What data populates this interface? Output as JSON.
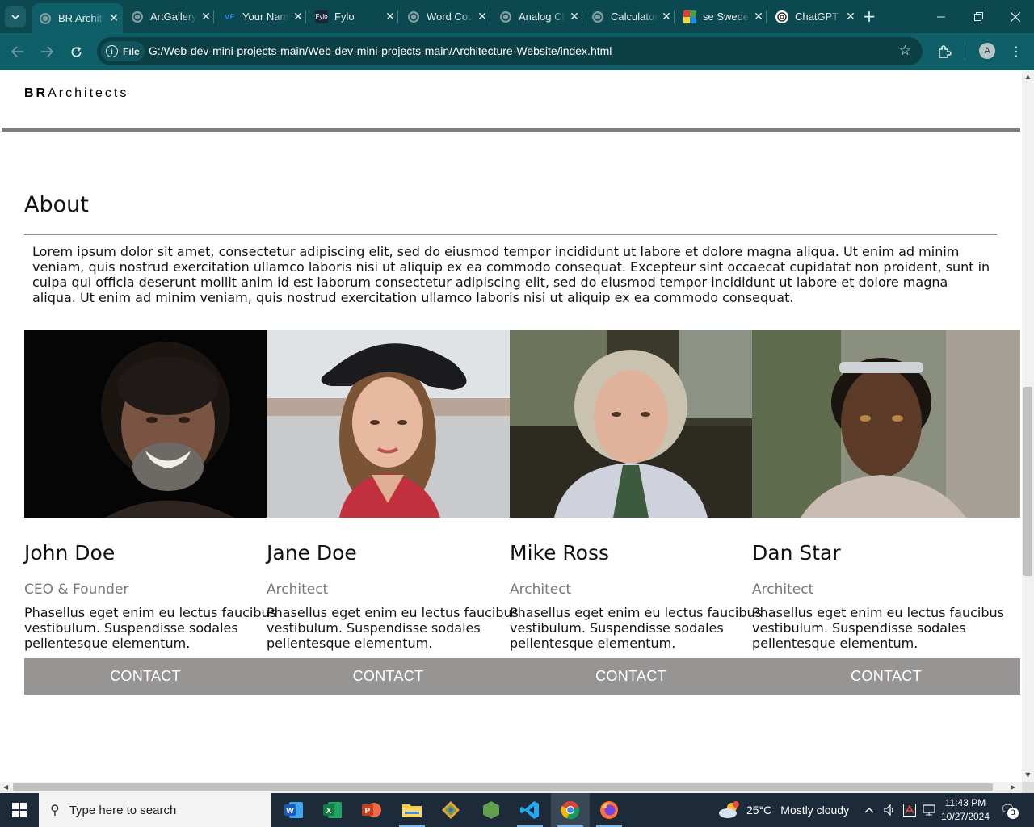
{
  "browser": {
    "tabs": [
      {
        "label": "BR Architects",
        "icon": "globe-icon",
        "active": true
      },
      {
        "label": "ArtGallery",
        "icon": "globe-icon"
      },
      {
        "label": "Your Name",
        "icon": "me-logo-icon",
        "favicon_text": "ME"
      },
      {
        "label": "Fylo",
        "icon": "fylo-logo-icon",
        "favicon_text": "Fylo"
      },
      {
        "label": "Word Counter",
        "icon": "globe-icon"
      },
      {
        "label": "Analog Clock",
        "icon": "globe-icon"
      },
      {
        "label": "Calculator",
        "icon": "globe-icon"
      },
      {
        "label": "se Sweden",
        "icon": "colorful-grid-icon"
      },
      {
        "label": "ChatGPT",
        "icon": "chatgpt-icon"
      }
    ],
    "omnibox": {
      "scheme_chip": "File",
      "url": "G:/Web-dev-mini-projects-main/Web-dev-mini-projects-main/Architecture-Website/index.html"
    },
    "profile_initial": "A"
  },
  "page": {
    "brand_bold": "BR",
    "brand_rest": "Architects",
    "about": {
      "title": "About",
      "text": "Lorem ipsum dolor sit amet, consectetur adipiscing elit, sed do eiusmod tempor incididunt ut labore et dolore magna aliqua. Ut enim ad minim veniam, quis nostrud exercitation ullamco laboris nisi ut aliquip ex ea commodo consequat. Excepteur sint occaecat cupidatat non proident, sunt in culpa qui officia deserunt mollit anim id est laborum consectetur adipiscing elit, sed do eiusmod tempor incididunt ut labore et dolore magna aliqua. Ut enim ad minim veniam, quis nostrud exercitation ullamco laboris nisi ut aliquip ex ea commodo consequat."
    },
    "team": [
      {
        "name": "John Doe",
        "role": "CEO & Founder",
        "desc": "Phasellus eget enim eu lectus faucibus vestibulum. Suspendisse sodales pellentesque elementum.",
        "contact": "CONTACT"
      },
      {
        "name": "Jane Doe",
        "role": "Architect",
        "desc": "Phasellus eget enim eu lectus faucibus vestibulum. Suspendisse sodales pellentesque elementum.",
        "contact": "CONTACT"
      },
      {
        "name": "Mike Ross",
        "role": "Architect",
        "desc": "Phasellus eget enim eu lectus faucibus vestibulum. Suspendisse sodales pellentesque elementum.",
        "contact": "CONTACT"
      },
      {
        "name": "Dan Star",
        "role": "Architect",
        "desc": "Phasellus eget enim eu lectus faucibus vestibulum. Suspendisse sodales pellentesque elementum.",
        "contact": "CONTACT"
      }
    ]
  },
  "taskbar": {
    "search_placeholder": "Type here to search",
    "weather_temp": "25°C",
    "weather_desc": "Mostly cloudy",
    "time": "11:43 PM",
    "date": "10/27/2024",
    "notification_count": "3"
  },
  "colors": {
    "tabbar": "#0b4850",
    "toolbar": "#0f5f69",
    "contact_button": "#979594",
    "role_text": "#787878"
  }
}
